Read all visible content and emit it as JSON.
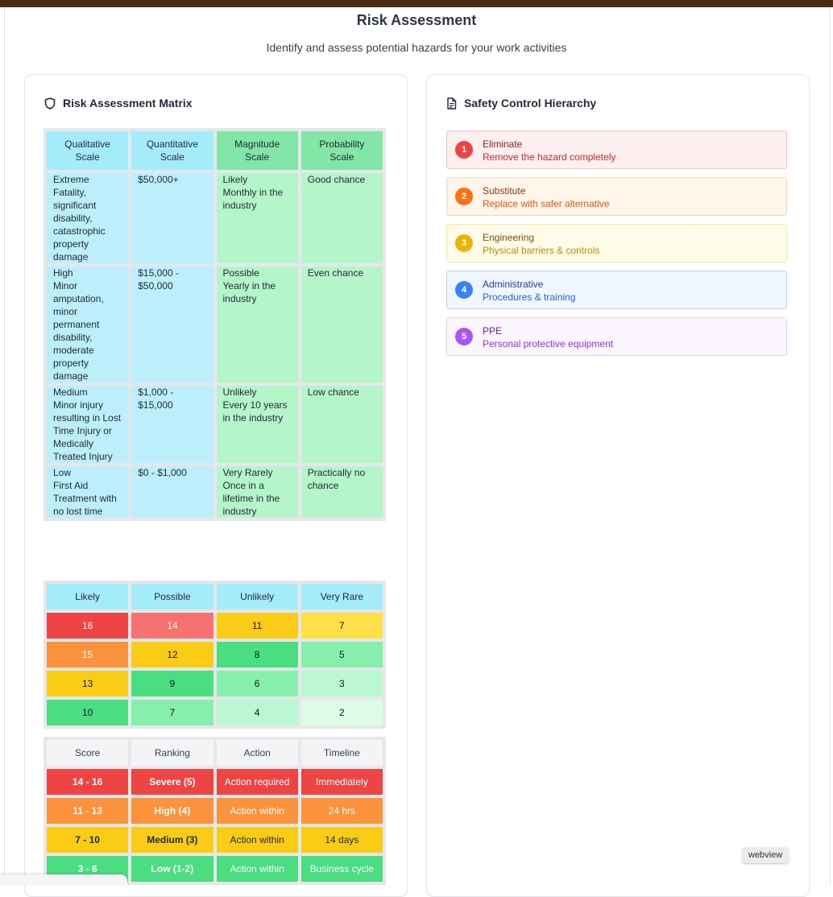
{
  "page": {
    "title": "Risk Assessment",
    "subtitle": "Identify and assess potential hazards for your work activities",
    "badge": "webview"
  },
  "matrix_card": {
    "title": "Risk Assessment Matrix",
    "icon": "shield-icon",
    "scale_headers": [
      "Qualitative Scale",
      "Quantitative Scale",
      "Magnitude Scale",
      "Probability Scale"
    ],
    "scale_rows": [
      [
        "Extreme\nFatality, significant disability, catastrophic property damage",
        "$50,000+",
        "Likely\nMonthly in the industry",
        "Good chance"
      ],
      [
        "High\nMinor amputation, minor permanent disability, moderate property damage",
        "$15,000 - $50,000",
        "Possible\nYearly in the industry",
        "Even chance"
      ],
      [
        "Medium\nMinor injury resulting in Lost Time Injury or Medically Treated Injury",
        "$1,000 - $15,000",
        "Unlikely\nEvery 10 years in the industry",
        "Low chance"
      ],
      [
        "Low\nFirst Aid Treatment with no lost time",
        "$0 - $1,000",
        "Very Rarely\nOnce in a lifetime in the industry",
        "Practically no chance"
      ]
    ],
    "matrix_headers": [
      "Likely",
      "Possible",
      "Unlikely",
      "Very Rare"
    ],
    "matrix_rows": [
      [
        "16",
        "14",
        "11",
        "7"
      ],
      [
        "15",
        "12",
        "8",
        "5"
      ],
      [
        "13",
        "9",
        "6",
        "3"
      ],
      [
        "10",
        "7",
        "4",
        "2"
      ]
    ],
    "matrix_colors": [
      [
        "#ef4444",
        "#f87171",
        "#facc15",
        "#fde047"
      ],
      [
        "#fb923c",
        "#facc15",
        "#4ade80",
        "#86efac"
      ],
      [
        "#facc15",
        "#4ade80",
        "#86efac",
        "#bbf7d0"
      ],
      [
        "#4ade80",
        "#86efac",
        "#bbf7d0",
        "#dcfce7"
      ]
    ],
    "legend_headers": [
      "Score",
      "Ranking",
      "Action",
      "Timeline"
    ],
    "legend_rows": [
      [
        "14 - 16",
        "Severe (5)",
        "Action required",
        "Immediately"
      ],
      [
        "11 - 13",
        "High (4)",
        "Action within",
        "24 hrs"
      ],
      [
        "7 - 10",
        "Medium (3)",
        "Action within",
        "14 days"
      ],
      [
        "3 - 6",
        "Low (1-2)",
        "Action within",
        "Business cycle"
      ]
    ],
    "legend_colors": [
      "#ef4444",
      "#fb923c",
      "#facc15",
      "#4ade80"
    ]
  },
  "hierarchy_card": {
    "title": "Safety Control Hierarchy",
    "icon": "document-icon",
    "items": [
      {
        "number": "1",
        "name": "Eliminate",
        "desc": "Remove the hazard completely",
        "bg": "#fef0f0",
        "border": "#f5c2c2",
        "circle": "#ef4444",
        "name_color": "#991b1b",
        "desc_color": "#dc2626"
      },
      {
        "number": "2",
        "name": "Substitute",
        "desc": "Replace with safer alternative",
        "bg": "#fff5ea",
        "border": "#fbd5ae",
        "circle": "#f97316",
        "name_color": "#9a3412",
        "desc_color": "#ea580c"
      },
      {
        "number": "3",
        "name": "Engineering",
        "desc": "Physical barriers & controls",
        "bg": "#fefbe8",
        "border": "#fae8a0",
        "circle": "#eab308",
        "name_color": "#854d0e",
        "desc_color": "#ca8a04"
      },
      {
        "number": "4",
        "name": "Administrative",
        "desc": "Procedures & training",
        "bg": "#eff6ff",
        "border": "#bfd4f5",
        "circle": "#3b82f6",
        "name_color": "#1e40af",
        "desc_color": "#2563eb"
      },
      {
        "number": "5",
        "name": "PPE",
        "desc": "Personal protective equipment",
        "bg": "#faf5ff",
        "border": "#e4cffa",
        "circle": "#a855f7",
        "name_color": "#6b21a8",
        "desc_color": "#9333ea"
      }
    ]
  }
}
